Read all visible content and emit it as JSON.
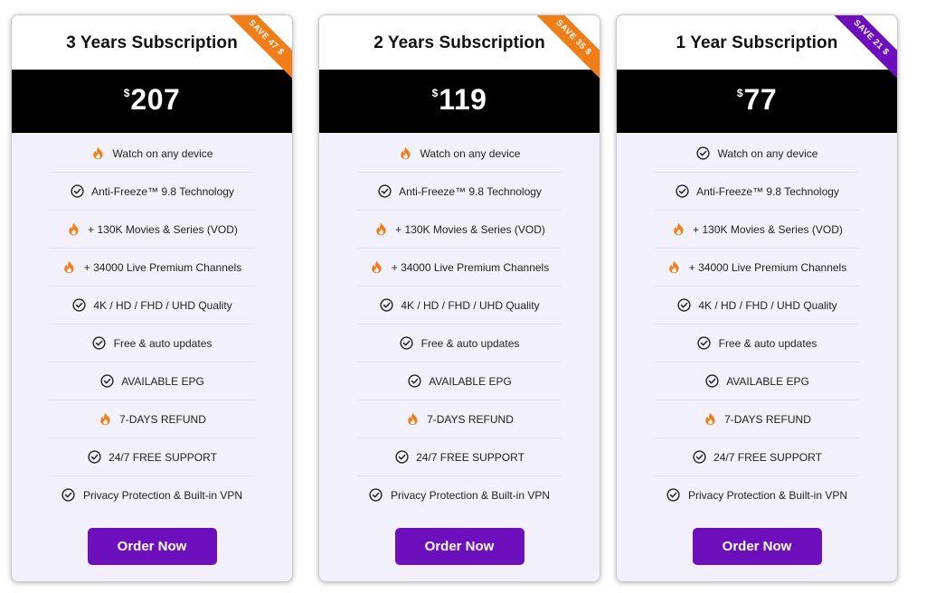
{
  "colors": {
    "accent": "#6e0fbd",
    "price_band": "#000000",
    "card_body": "#f2f0fb",
    "fire": "#f07d18",
    "ribbon_orange": "#f07d18",
    "ribbon_purple": "#6e0fbd"
  },
  "plans": [
    {
      "title": "3 Years Subscription",
      "ribbon": "SAVE 47 $",
      "ribbon_color": "orange",
      "currency": "$",
      "price": "207",
      "features": [
        {
          "icon": "fire-icon",
          "label": "Watch on any device"
        },
        {
          "icon": "check-circle-icon",
          "label": "Anti-Freeze™ 9.8 Technology"
        },
        {
          "icon": "fire-icon",
          "label": "+ 130K Movies & Series (VOD)"
        },
        {
          "icon": "fire-icon",
          "label": "+ 34000 Live Premium Channels"
        },
        {
          "icon": "check-circle-icon",
          "label": "4K / HD / FHD / UHD Quality"
        },
        {
          "icon": "check-circle-icon",
          "label": "Free & auto updates"
        },
        {
          "icon": "check-circle-icon",
          "label": "AVAILABLE EPG"
        },
        {
          "icon": "fire-icon",
          "label": "7-DAYS REFUND"
        },
        {
          "icon": "check-circle-icon",
          "label": "24/7 FREE SUPPORT"
        },
        {
          "icon": "check-circle-icon",
          "label": "Privacy Protection & Built-in VPN"
        }
      ],
      "button": "Order Now"
    },
    {
      "title": "2 Years Subscription",
      "ribbon": "SAVE 35 $",
      "ribbon_color": "orange",
      "currency": "$",
      "price": "119",
      "features": [
        {
          "icon": "fire-icon",
          "label": "Watch on any device"
        },
        {
          "icon": "check-circle-icon",
          "label": "Anti-Freeze™ 9.8 Technology"
        },
        {
          "icon": "fire-icon",
          "label": "+ 130K Movies & Series (VOD)"
        },
        {
          "icon": "fire-icon",
          "label": "+ 34000 Live Premium Channels"
        },
        {
          "icon": "check-circle-icon",
          "label": "4K / HD / FHD / UHD Quality"
        },
        {
          "icon": "check-circle-icon",
          "label": "Free & auto updates"
        },
        {
          "icon": "check-circle-icon",
          "label": "AVAILABLE EPG"
        },
        {
          "icon": "fire-icon",
          "label": "7-DAYS REFUND"
        },
        {
          "icon": "check-circle-icon",
          "label": "24/7 FREE SUPPORT"
        },
        {
          "icon": "check-circle-icon",
          "label": "Privacy Protection & Built-in VPN"
        }
      ],
      "button": "Order Now"
    },
    {
      "title": "1 Year Subscription",
      "ribbon": "SAVE 21 $",
      "ribbon_color": "purple",
      "currency": "$",
      "price": "77",
      "features": [
        {
          "icon": "check-circle-icon",
          "label": "Watch on any device"
        },
        {
          "icon": "check-circle-icon",
          "label": "Anti-Freeze™ 9.8 Technology"
        },
        {
          "icon": "fire-icon",
          "label": "+ 130K Movies & Series (VOD)"
        },
        {
          "icon": "fire-icon",
          "label": "+ 34000 Live Premium Channels"
        },
        {
          "icon": "check-circle-icon",
          "label": "4K / HD / FHD / UHD Quality"
        },
        {
          "icon": "check-circle-icon",
          "label": "Free & auto updates"
        },
        {
          "icon": "check-circle-icon",
          "label": "AVAILABLE EPG"
        },
        {
          "icon": "fire-icon",
          "label": "7-DAYS REFUND"
        },
        {
          "icon": "check-circle-icon",
          "label": "24/7 FREE SUPPORT"
        },
        {
          "icon": "check-circle-icon",
          "label": "Privacy Protection & Built-in VPN"
        }
      ],
      "button": "Order Now"
    }
  ]
}
